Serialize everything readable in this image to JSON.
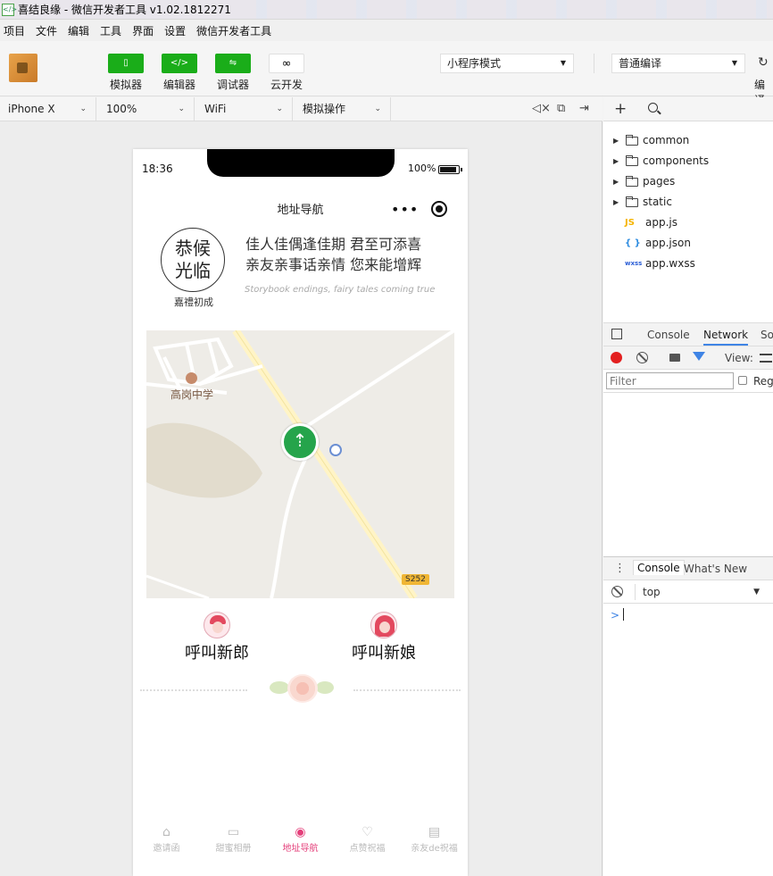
{
  "window": {
    "title": "喜结良缘 - 微信开发者工具 v1.02.1812271"
  },
  "menu": {
    "items": [
      "项目",
      "文件",
      "编辑",
      "工具",
      "界面",
      "设置",
      "微信开发者工具"
    ]
  },
  "toolbar": {
    "simulator_label": "模拟器",
    "editor_label": "编辑器",
    "debugger_label": "调试器",
    "cloud_label": "云开发",
    "mode_select": "小程序模式",
    "compile_select": "普通编译",
    "compile_label": "编译"
  },
  "simbar": {
    "device": "iPhone X",
    "zoom": "100%",
    "network": "WiFi",
    "operations": "模拟操作"
  },
  "phone": {
    "status_time": "18:36",
    "battery": "100%",
    "battery_level": 1.0,
    "nav_title": "地址导航",
    "nav_dots": "•••",
    "seal_line1": "恭候",
    "seal_line2": "光临",
    "seal_sub": "嘉禮初成",
    "poem_line1": "佳人佳偶逢佳期  君至可添喜",
    "poem_line2": "亲友亲事话亲情  您来能增辉",
    "poem_en": "Storybook endings, fairy tales coming true",
    "map_place": "高岗中学",
    "map_road": "S252",
    "call_groom": "呼叫新郎",
    "call_bride": "呼叫新娘",
    "tabs": [
      {
        "label": "邀请函",
        "icon": "home-icon",
        "glyph": "⌂"
      },
      {
        "label": "甜蜜相册",
        "icon": "album-icon",
        "glyph": "▭"
      },
      {
        "label": "地址导航",
        "icon": "location-icon",
        "glyph": "◉"
      },
      {
        "label": "点赞祝福",
        "icon": "heart-icon",
        "glyph": "♡"
      },
      {
        "label": "亲友de祝福",
        "icon": "message-icon",
        "glyph": "▤"
      }
    ],
    "active_color": "#e43f7a"
  },
  "files": {
    "folders": [
      "common",
      "components",
      "pages",
      "static"
    ],
    "files": [
      {
        "icon_text": "JS",
        "name": "app.js",
        "type": "js"
      },
      {
        "icon_text": "{ }",
        "name": "app.json",
        "type": "json"
      },
      {
        "icon_text": "wxss",
        "name": "app.wxss",
        "type": "wxss"
      }
    ]
  },
  "devtools": {
    "tabs": [
      "Console",
      "Network",
      "So"
    ],
    "view_label": "View:",
    "filter_placeholder": "Filter",
    "regex_label": "Rege",
    "drawer_tabs": [
      "Console",
      "What's New"
    ],
    "context": "top",
    "prompt": ">"
  },
  "colors": {
    "accent_green": "#1aad19",
    "record_red": "#e32020",
    "link_blue": "#3f84e5"
  }
}
